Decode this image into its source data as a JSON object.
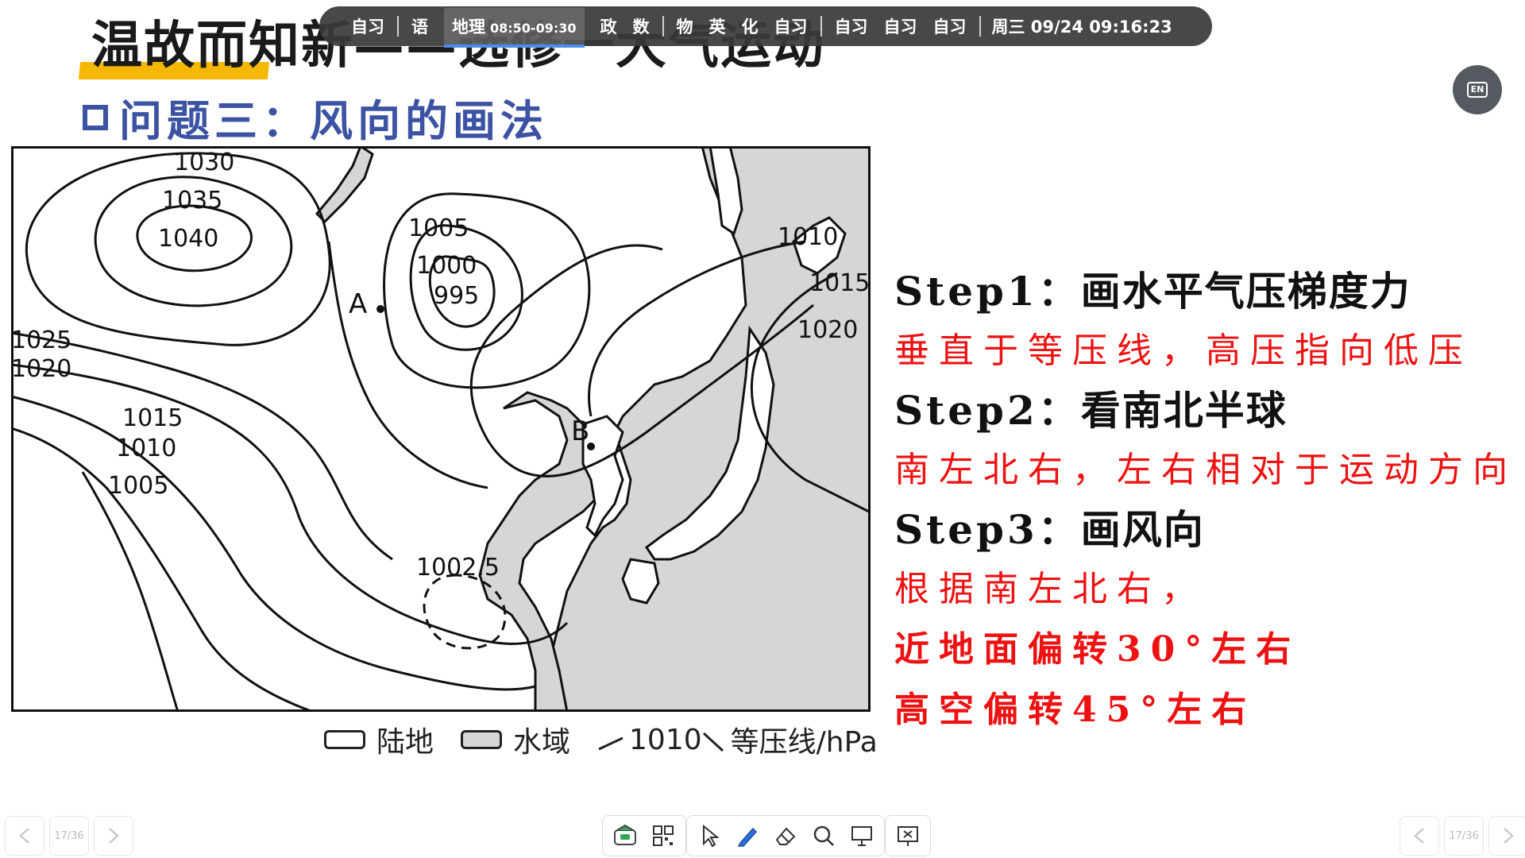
{
  "slide": {
    "title": "温故而知新——选修一大气运动",
    "subtitle": "问题三：风向的画法",
    "accent_color": "#3c53a3",
    "underline_color": "#f5b800"
  },
  "schedule": {
    "items": [
      {
        "label": "自习"
      },
      {
        "label": "语"
      },
      {
        "label": "地理",
        "time": "08:50-09:30",
        "active": true
      },
      {
        "label": "政"
      },
      {
        "label": "数"
      },
      {
        "label": "物"
      },
      {
        "label": "英"
      },
      {
        "label": "化"
      },
      {
        "label": "自习"
      },
      {
        "label": "自习"
      },
      {
        "label": "自习"
      },
      {
        "label": "自习"
      }
    ],
    "clock": "周三 09/24  09:16:23"
  },
  "lang_button": {
    "label": "EN"
  },
  "map": {
    "isobar_labels": [
      "1030",
      "1035",
      "1040",
      "1005",
      "1000",
      "995",
      "1010",
      "1015",
      "1020",
      "1025",
      "1020",
      "1015",
      "1010",
      "1005",
      "1002.5"
    ],
    "point_labels": [
      "A",
      "B"
    ],
    "legend": {
      "land": "陆地",
      "water": "水域",
      "isobar_value": "1010",
      "isobar_text": "等压线/hPa"
    }
  },
  "steps": [
    {
      "label": "Step1：",
      "title": "画水平气压梯度力",
      "desc": [
        "垂直于等压线，高压指向低压"
      ]
    },
    {
      "label": "Step2：",
      "title": "看南北半球",
      "desc": [
        "南左北右，左右相对于运动方向"
      ]
    },
    {
      "label": "Step3：",
      "title": "画风向",
      "desc": [
        "根据南左北右，",
        "近地面偏转30°左右",
        "高空偏转45°左右"
      ]
    }
  ],
  "pager": {
    "left": "17/36",
    "right": "17/36"
  },
  "toolbar": {
    "icons": [
      "chat-icon",
      "grid-icon",
      "pointer-icon",
      "pen-icon",
      "eraser-icon",
      "magnifier-icon",
      "board-icon",
      "exit-icon"
    ]
  }
}
